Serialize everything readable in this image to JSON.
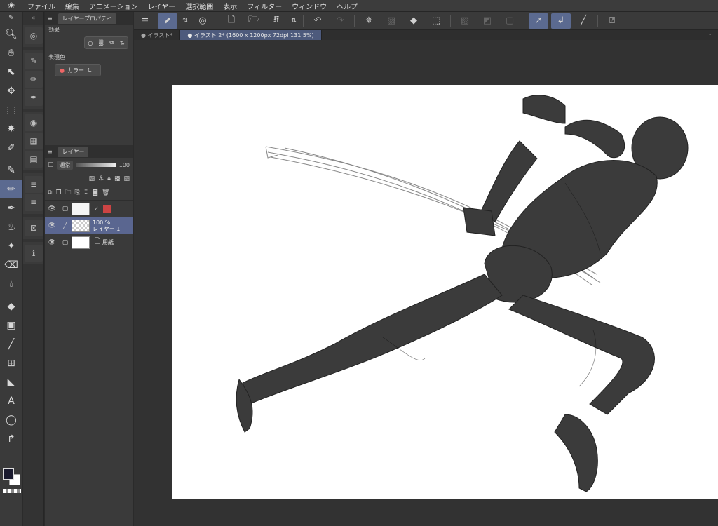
{
  "menu": {
    "items": [
      "ファイル",
      "編集",
      "アニメーション",
      "レイヤー",
      "選択範囲",
      "表示",
      "フィルター",
      "ウィンドウ",
      "ヘルプ"
    ]
  },
  "layer_property_panel": {
    "tab": "レイヤープロパティ",
    "effect_label": "効果",
    "expression_color_label": "表現色",
    "expression_color_value": "カラー"
  },
  "layer_panel": {
    "tab": "レイヤー",
    "blend_mode": "通常",
    "opacity": "100",
    "layers": [
      {
        "opacity": "",
        "name": ""
      },
      {
        "opacity": "100 %",
        "name": "レイヤー 1"
      },
      {
        "opacity": "",
        "name": "用紙"
      }
    ]
  },
  "document_tabs": [
    {
      "label": "● イラスト*"
    },
    {
      "label": "● イラスト 2* (1600 x 1200px 72dpi 131.5%)"
    }
  ],
  "colors": {
    "accent": "#5b6a90",
    "canvas_bg": "#323232",
    "panel_bg": "#3a3a3a"
  }
}
